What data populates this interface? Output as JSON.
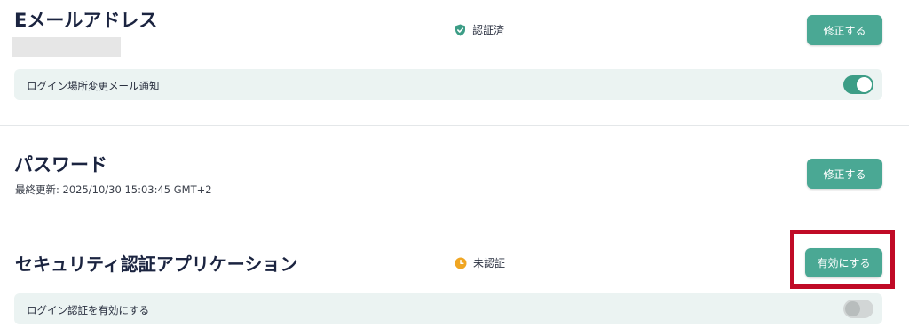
{
  "email_section": {
    "title": "Eメールアドレス",
    "status": "認証済",
    "button": "修正する",
    "login_location_label": "ログイン場所変更メール通知",
    "login_location_enabled": true
  },
  "password_section": {
    "title": "パスワード",
    "last_updated": "最終更新: 2025/10/30 15:03:45 GMT+2",
    "button": "修正する"
  },
  "authenticator_section": {
    "title": "セキュリティ認証アプリケーション",
    "status": "未認証",
    "button": "有効にする",
    "login_auth_label": "ログイン認証を有効にする",
    "login_auth_enabled": false
  },
  "colors": {
    "accent": "#4aa894",
    "verified_icon": "#3c9d86",
    "pending_icon": "#f0a623",
    "highlight": "#c00a26"
  },
  "icons": {
    "verified": "shield-check-icon",
    "pending": "clock-icon"
  }
}
